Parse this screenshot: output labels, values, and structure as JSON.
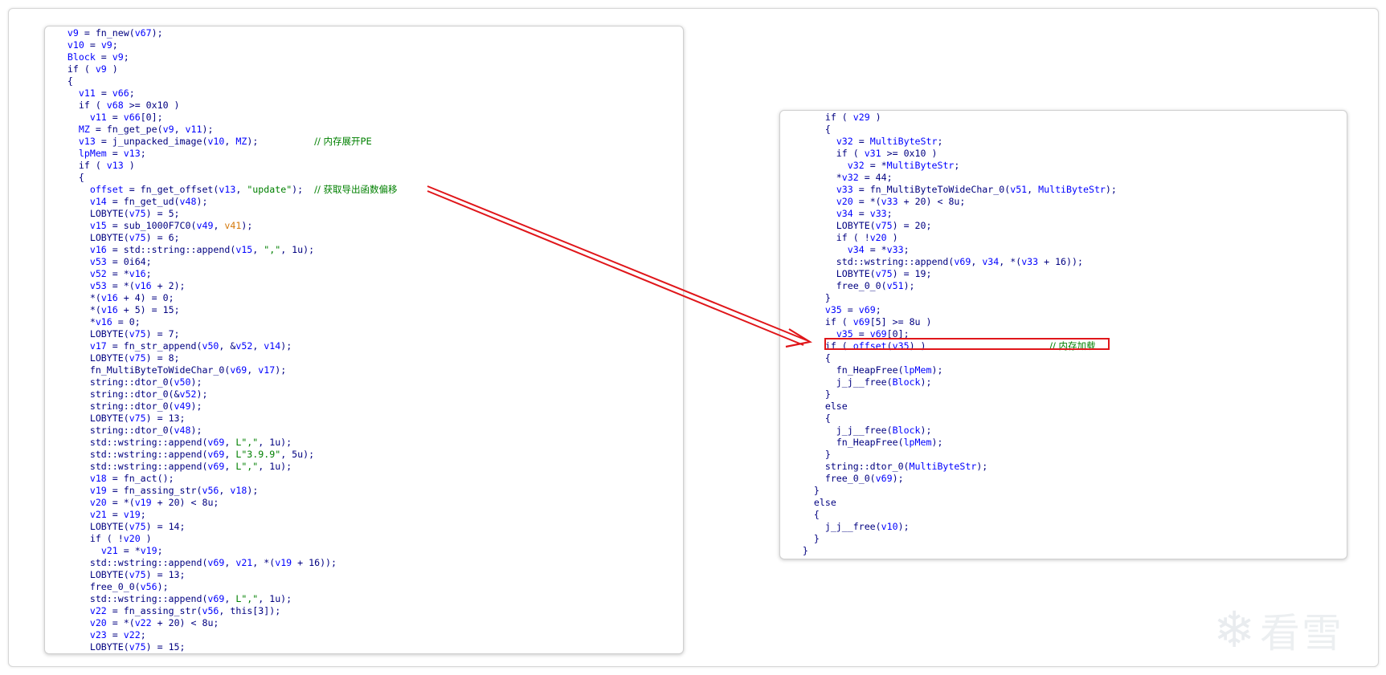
{
  "left_code": [
    "    v9 = fn_new(v67);",
    "    v10 = v9;",
    "    Block = v9;",
    "    if ( v9 )",
    "    {",
    "      v11 = v66;",
    "      if ( v68 >= 0x10 )",
    "        v11 = v66[0];",
    "      MZ = fn_get_pe(v9, v11);",
    "      v13 = j_unpacked_image(v10, MZ);          // 内存展开PE",
    "      lpMem = v13;",
    "      if ( v13 )",
    "      {",
    "        offset = fn_get_offset(v13, \"update\");  // 获取导出函数偏移",
    "        v14 = fn_get_ud(v48);",
    "        LOBYTE(v75) = 5;",
    "        v15 = sub_1000F7C0(v49, v41);",
    "        LOBYTE(v75) = 6;",
    "        v16 = std::string::append(v15, \",\", 1u);",
    "        v53 = 0i64;",
    "        v52 = *v16;",
    "        v53 = *(v16 + 2);",
    "        *(v16 + 4) = 0;",
    "        *(v16 + 5) = 15;",
    "        *v16 = 0;",
    "        LOBYTE(v75) = 7;",
    "        v17 = fn_str_append(v50, &v52, v14);",
    "        LOBYTE(v75) = 8;",
    "        fn_MultiByteToWideChar_0(v69, v17);",
    "        string::dtor_0(v50);",
    "        string::dtor_0(&v52);",
    "        string::dtor_0(v49);",
    "        LOBYTE(v75) = 13;",
    "        string::dtor_0(v48);",
    "        std::wstring::append(v69, L\",\", 1u);",
    "        std::wstring::append(v69, L\"3.9.9\", 5u);",
    "        std::wstring::append(v69, L\",\", 1u);",
    "        v18 = fn_act();",
    "        v19 = fn_assing_str(v56, v18);",
    "        v20 = *(v19 + 20) < 8u;",
    "        v21 = v19;",
    "        LOBYTE(v75) = 14;",
    "        if ( !v20 )",
    "          v21 = *v19;",
    "        std::wstring::append(v69, v21, *(v19 + 16));",
    "        LOBYTE(v75) = 13;",
    "        free_0_0(v56);",
    "        std::wstring::append(v69, L\",\", 1u);",
    "        v22 = fn_assing_str(v56, this[3]);",
    "        v20 = *(v22 + 20) < 8u;",
    "        v23 = v22;",
    "        LOBYTE(v75) = 15;"
  ],
  "right_code": [
    "        if ( v29 )",
    "        {",
    "          v32 = MultiByteStr;",
    "          if ( v31 >= 0x10 )",
    "            v32 = *MultiByteStr;",
    "          *v32 = 44;",
    "          v33 = fn_MultiByteToWideChar_0(v51, MultiByteStr);",
    "          v20 = *(v33 + 20) < 8u;",
    "          v34 = v33;",
    "          LOBYTE(v75) = 20;",
    "          if ( !v20 )",
    "            v34 = *v33;",
    "          std::wstring::append(v69, v34, *(v33 + 16));",
    "          LOBYTE(v75) = 19;",
    "          free_0_0(v51);",
    "        }",
    "        v35 = v69;",
    "        if ( v69[5] >= 8u )",
    "          v35 = v69[0];",
    "        if ( offset(v35) )                      // 内存加载",
    "        {",
    "          fn_HeapFree(lpMem);",
    "          j_j__free(Block);",
    "        }",
    "        else",
    "        {",
    "          j_j__free(Block);",
    "          fn_HeapFree(lpMem);",
    "        }",
    "        string::dtor_0(MultiByteStr);",
    "        free_0_0(v69);",
    "      }",
    "      else",
    "      {",
    "        j_j__free(v10);",
    "      }",
    "    }"
  ],
  "colors": {
    "code_text": "#000080",
    "variable": "#0000ff",
    "string_literal": "#008000",
    "comment": "#008000",
    "highlight_box": "#e0161a",
    "arrow": "#e0161a"
  },
  "watermark": {
    "icon": "snowflake-icon",
    "text": "看雪"
  }
}
